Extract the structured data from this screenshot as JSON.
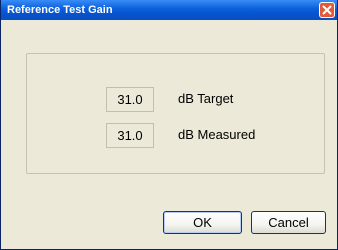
{
  "window": {
    "title": "Reference Test Gain"
  },
  "colors": {
    "titlebar": "#0a5fd8",
    "dialog_background": "#ece9d8",
    "close_button": "#e25a3a"
  },
  "icons": {
    "close": "close-icon"
  },
  "fields": [
    {
      "value": "31.0",
      "label": "dB Target"
    },
    {
      "value": "31.0",
      "label": "dB Measured"
    }
  ],
  "buttons": {
    "ok_label": "OK",
    "cancel_label": "Cancel"
  }
}
